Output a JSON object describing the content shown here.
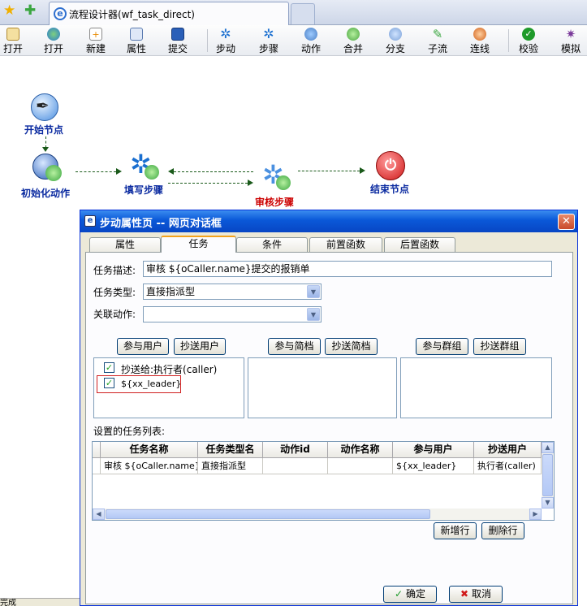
{
  "browser": {
    "tab_title": "流程设计器(wf_task_direct)"
  },
  "toolbar": {
    "items": [
      {
        "label": "打开",
        "icon": "open-file-icon"
      },
      {
        "label": "打开",
        "icon": "open-globe-icon"
      },
      {
        "label": "新建",
        "icon": "new-file-icon"
      },
      {
        "label": "属性",
        "icon": "properties-icon"
      },
      {
        "label": "提交",
        "icon": "save-disk-icon"
      },
      {
        "label": "步动",
        "icon": "gear-icon"
      },
      {
        "label": "步骤",
        "icon": "gear-icon"
      },
      {
        "label": "动作",
        "icon": "user-action-icon"
      },
      {
        "label": "合并",
        "icon": "merge-icon"
      },
      {
        "label": "分支",
        "icon": "split-icon"
      },
      {
        "label": "子流",
        "icon": "subflow-icon"
      },
      {
        "label": "连线",
        "icon": "connect-icon"
      },
      {
        "label": "校验",
        "icon": "check-icon"
      },
      {
        "label": "模拟",
        "icon": "simulate-icon"
      }
    ]
  },
  "canvas": {
    "nodes": {
      "start": "开始节点",
      "init": "初始化动作",
      "fill": "填写步骤",
      "review": "审核步骤",
      "end": "结束节点"
    }
  },
  "dialog": {
    "title": "步动属性页 -- 网页对话框",
    "close": "✕",
    "tabs": [
      "属性",
      "任务",
      "条件",
      "前置函数",
      "后置函数"
    ],
    "active_tab": "任务",
    "fields": {
      "desc_label": "任务描述:",
      "desc_value": "审核 ${oCaller.name}提交的报销单",
      "type_label": "任务类型:",
      "type_value": "直接指派型",
      "action_label": "关联动作:",
      "action_value": ""
    },
    "buttons": {
      "participant_user": "参与用户",
      "cc_user": "抄送用户",
      "participant_brief": "参与简档",
      "cc_brief": "抄送简档",
      "participant_group": "参与群组",
      "cc_group": "抄送群组",
      "add_row": "新增行",
      "delete_row": "删除行",
      "ok": "确定",
      "cancel": "取消"
    },
    "user_list": [
      {
        "text": "抄送给:执行者(caller)",
        "checked": true
      },
      {
        "text": "${xx_leader}",
        "checked": true
      }
    ],
    "task_list_label": "设置的任务列表:",
    "grid": {
      "columns": [
        "任务名称",
        "任务类型名",
        "动作id",
        "动作名称",
        "参与用户",
        "抄送用户"
      ],
      "rows": [
        [
          "审核 ${oCaller.name}",
          "直接指派型",
          "",
          "",
          "${xx_leader}",
          "执行者(caller)"
        ]
      ]
    }
  },
  "status": {
    "text": "完成"
  },
  "colors": {
    "dialog_title": "#0a58d8",
    "node_label": "#0a2aa0",
    "review_label": "#cc0000"
  }
}
